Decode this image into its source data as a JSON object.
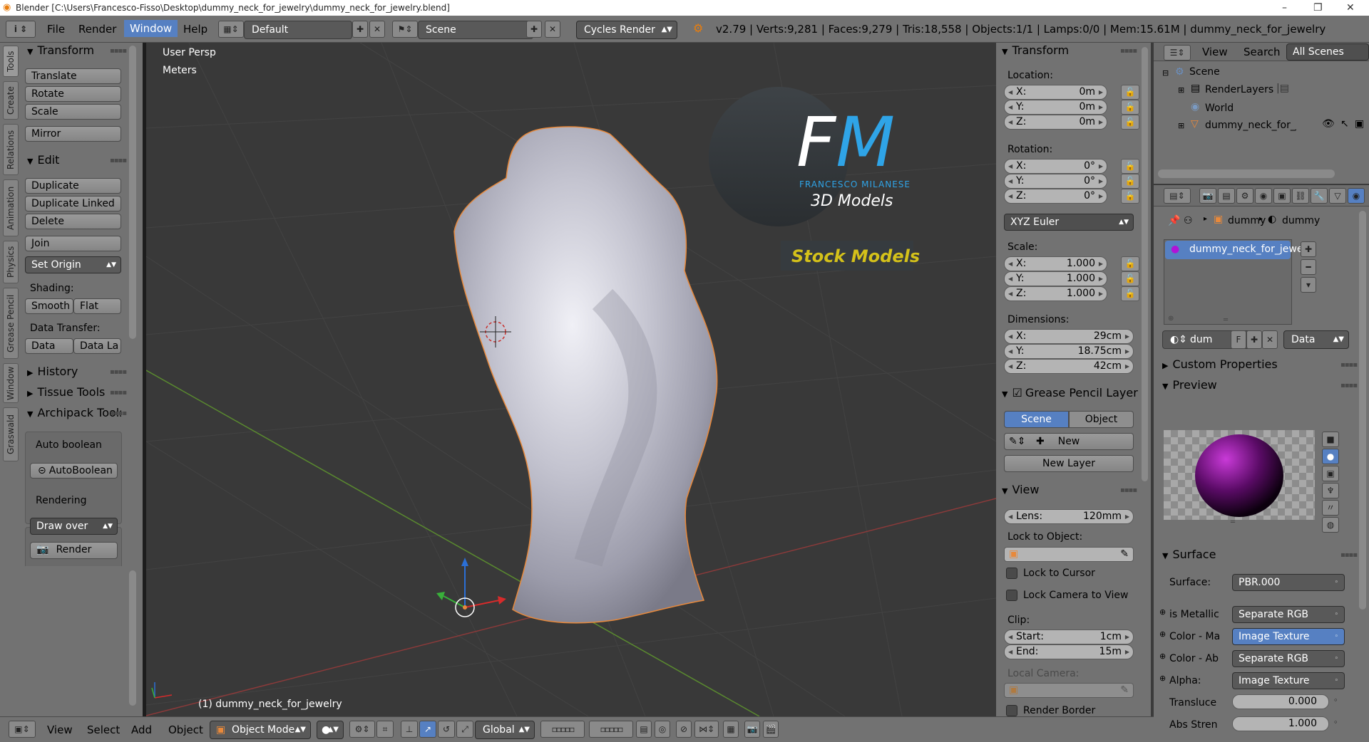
{
  "window": {
    "title": "Blender [C:\\Users\\Francesco-Fisso\\Desktop\\dummy_neck_for_jewelry\\dummy_neck_for_jewelry.blend]",
    "minimize": "–",
    "maximize": "❐",
    "close": "✕"
  },
  "topbar": {
    "info_icon": "i",
    "menus": [
      "File",
      "Render",
      "Window",
      "Help"
    ],
    "active_menu": "Window",
    "layout": "Default",
    "scene": "Scene",
    "engine": "Cycles Render",
    "stats": "v2.79 | Verts:9,281 | Faces:9,279 | Tris:18,558 | Objects:1/1 | Lamps:0/0 | Mem:15.61M | dummy_neck_for_jewelry"
  },
  "left_tabs": [
    "Tools",
    "Create",
    "Relations",
    "Animation",
    "Physics",
    "Grease Pencil",
    "Window",
    "Graswald"
  ],
  "toolshelf": {
    "transform": {
      "title": "Transform",
      "buttons": [
        "Translate",
        "Rotate",
        "Scale",
        "Mirror"
      ]
    },
    "edit": {
      "title": "Edit",
      "buttons": [
        "Duplicate",
        "Duplicate Linked",
        "Delete",
        "Join"
      ],
      "set_origin": "Set Origin",
      "shading_label": "Shading:",
      "smooth": "Smooth",
      "flat": "Flat",
      "data_transfer_label": "Data Transfer:",
      "data": "Data",
      "data_la": "Data La"
    },
    "history": "History",
    "tissue": "Tissue Tools",
    "archipack": "Archipack Tools",
    "auto_boolean_label": "Auto boolean",
    "auto_boolean_btn": "AutoBoolean",
    "rendering_label": "Rendering",
    "draw_over": "Draw over",
    "render_btn": "Render"
  },
  "viewport": {
    "view_name": "User Persp",
    "units": "Meters",
    "object_label": "(1) dummy_neck_for_jewelry",
    "watermark": {
      "letters_f": "F",
      "letters_m": "M",
      "author": "FRANCESCO MILANESE",
      "subtitle": "3D Models",
      "banner": "Stock Models"
    },
    "colors": {
      "bg": "#393939",
      "grid": "#434343",
      "x_axis": "#8b3a3a",
      "y_axis": "#5a8a2f",
      "mesh": "#c8c8d2",
      "outline": "#e8893b"
    }
  },
  "npanel": {
    "transform_title": "Transform",
    "location_label": "Location:",
    "location": [
      {
        "axis": "X:",
        "value": "0m"
      },
      {
        "axis": "Y:",
        "value": "0m"
      },
      {
        "axis": "Z:",
        "value": "0m"
      }
    ],
    "rotation_label": "Rotation:",
    "rotation": [
      {
        "axis": "X:",
        "value": "0°"
      },
      {
        "axis": "Y:",
        "value": "0°"
      },
      {
        "axis": "Z:",
        "value": "0°"
      }
    ],
    "rotation_mode": "XYZ Euler",
    "scale_label": "Scale:",
    "scale": [
      {
        "axis": "X:",
        "value": "1.000"
      },
      {
        "axis": "Y:",
        "value": "1.000"
      },
      {
        "axis": "Z:",
        "value": "1.000"
      }
    ],
    "dimensions_label": "Dimensions:",
    "dimensions": [
      {
        "axis": "X:",
        "value": "29cm"
      },
      {
        "axis": "Y:",
        "value": "18.75cm"
      },
      {
        "axis": "Z:",
        "value": "42cm"
      }
    ],
    "grease_title": "Grease Pencil Layer",
    "scene_tab": "Scene",
    "object_tab": "Object",
    "new": "New",
    "new_layer": "New Layer",
    "view_title": "View",
    "lens_label": "Lens:",
    "lens_value": "120mm",
    "lock_to_object": "Lock to Object:",
    "lock_to_cursor": "Lock to Cursor",
    "lock_camera": "Lock Camera to View",
    "clip_label": "Clip:",
    "clip_start_label": "Start:",
    "clip_start": "1cm",
    "clip_end_label": "End:",
    "clip_end": "15m",
    "local_camera": "Local Camera:",
    "render_border": "Render Border"
  },
  "outliner": {
    "view": "View",
    "search": "Search",
    "filter": "All Scenes",
    "items": [
      "Scene",
      "RenderLayers",
      "World",
      "dummy_neck_for_jewe"
    ]
  },
  "properties": {
    "breadcrumb": [
      "dummy",
      "dummy"
    ],
    "material_slot": "dummy_neck_for_jewelry",
    "mat_field": "dum",
    "f_label": "F",
    "data_dropdown": "Data",
    "custom_props": "Custom Properties",
    "preview": "Preview",
    "surface_title": "Surface",
    "surface_label": "Surface:",
    "surface_value": "PBR.000",
    "rows": [
      {
        "label": "is Metallic",
        "value": "Separate RGB",
        "blue": false
      },
      {
        "label": "Color - Ma",
        "value": "Image Texture",
        "blue": true
      },
      {
        "label": "Color - Ab",
        "value": "Separate RGB",
        "blue": false
      },
      {
        "label": "Alpha:",
        "value": "Image Texture",
        "blue": false
      }
    ],
    "transluce_label": "Transluce",
    "transluce_value": "0.000",
    "abs_label": "Abs Stren",
    "abs_value": "1.000"
  },
  "bottombar": {
    "menus": [
      "View",
      "Select",
      "Add",
      "Object"
    ],
    "mode": "Object Mode",
    "orientation": "Global"
  }
}
